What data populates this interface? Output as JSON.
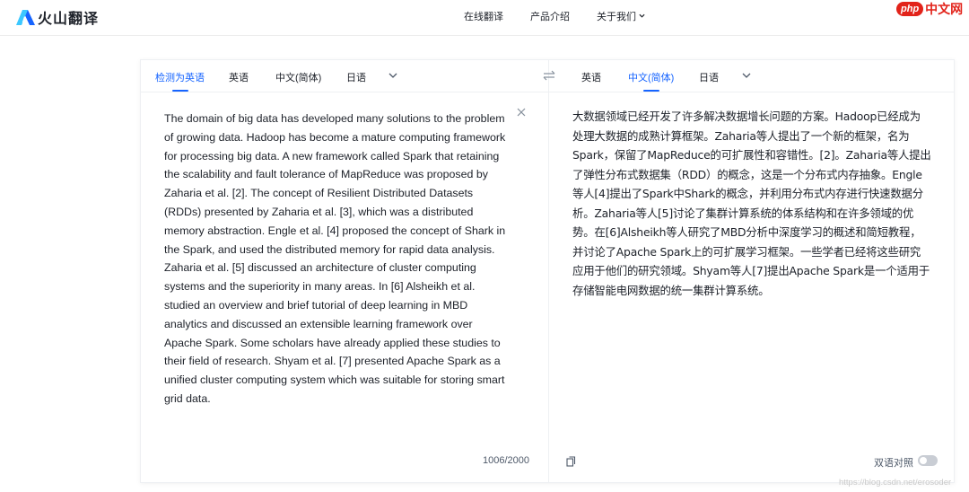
{
  "header": {
    "logo_text": "火山翻译",
    "nav": [
      {
        "label": "在线翻译"
      },
      {
        "label": "产品介绍"
      },
      {
        "label": "关于我们"
      }
    ]
  },
  "watermark_brand": {
    "badge": "php",
    "text": "中文网"
  },
  "source": {
    "tabs": [
      {
        "label": "检测为英语",
        "active": true
      },
      {
        "label": "英语",
        "active": false
      },
      {
        "label": "中文(简体)",
        "active": false
      },
      {
        "label": "日语",
        "active": false
      }
    ],
    "text": "The domain of big data has developed many solutions to the problem of growing data. Hadoop has become a mature computing framework for processing big data. A new framework called Spark that retaining the scalability and fault tolerance of MapReduce was proposed by Zaharia et al. [2]. The concept of Resilient Distributed Datasets (RDDs) presented by Zaharia et al. [3], which was a distributed memory abstraction. Engle et al. [4] proposed the concept of Shark in the Spark, and used the distributed memory for rapid data analysis. Zaharia et al. [5] discussed an architecture of cluster computing systems and the superiority in many areas. In [6] Alsheikh et al. studied an overview and brief tutorial of deep learning in MBD analytics and discussed an extensible learning framework over Apache Spark. Some scholars have already applied these studies to their field of research. Shyam et al. [7] presented Apache Spark as a unified cluster computing system which was suitable for storing smart grid data.",
    "char_count": "1006/2000"
  },
  "target": {
    "tabs": [
      {
        "label": "英语",
        "active": false
      },
      {
        "label": "中文(简体)",
        "active": true
      },
      {
        "label": "日语",
        "active": false
      }
    ],
    "text": "大数据领域已经开发了许多解决数据增长问题的方案。Hadoop已经成为处理大数据的成熟计算框架。Zaharia等人提出了一个新的框架，名为Spark，保留了MapReduce的可扩展性和容错性。[2]。Zaharia等人提出了弹性分布式数据集（RDD）的概念，这是一个分布式内存抽象。Engle等人[4]提出了Spark中Shark的概念，并利用分布式内存进行快速数据分析。Zaharia等人[5]讨论了集群计算系统的体系结构和在许多领域的优势。在[6]Alsheikh等人研究了MBD分析中深度学习的概述和简短教程，并讨论了Apache Spark上的可扩展学习框架。一些学者已经将这些研究应用于他们的研究领域。Shyam等人[7]提出Apache Spark是一个适用于存储智能电网数据的统一集群计算系统。",
    "bilingual_label": "双语对照",
    "bilingual_on": false
  },
  "footer_watermark": "https://blog.csdn.net/erosoder",
  "colors": {
    "accent": "#1664ff",
    "text": "#1d2129",
    "muted": "#4e5969",
    "brand_red": "#e2231a"
  }
}
